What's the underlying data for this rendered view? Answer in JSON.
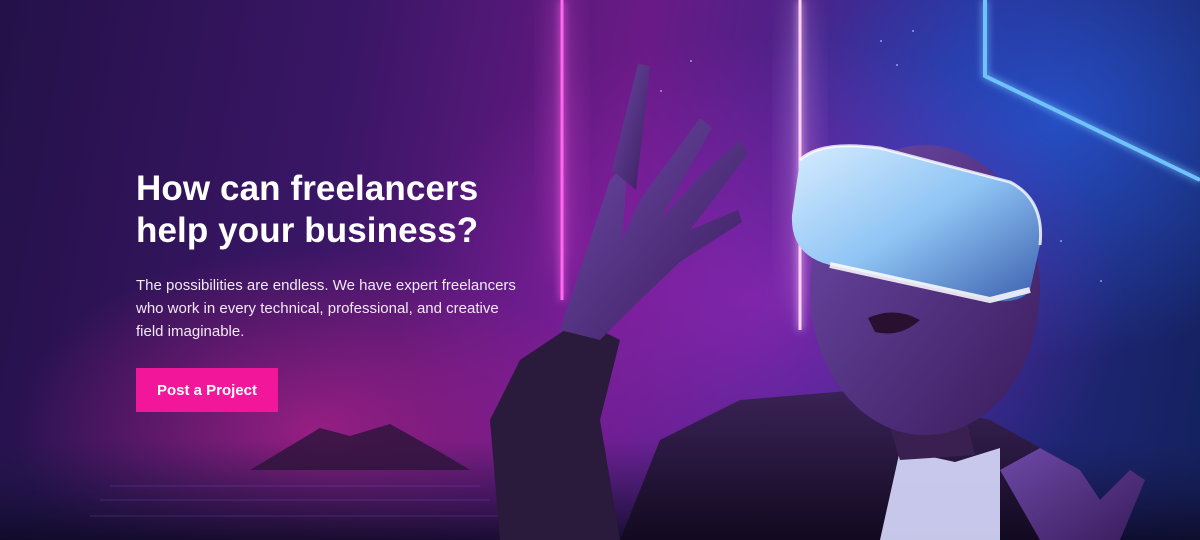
{
  "hero": {
    "headline_line1": "How can freelancers",
    "headline_line2": "help your business?",
    "body": "The possibilities are endless. We have expert freelancers who work in every technical, professional, and creative field imaginable.",
    "cta_label": "Post a Project"
  },
  "colors": {
    "accent": "#f2169a",
    "headline": "#ffffff",
    "neon_pink": "#ff5ae6",
    "neon_blue": "#4aa8ff"
  }
}
